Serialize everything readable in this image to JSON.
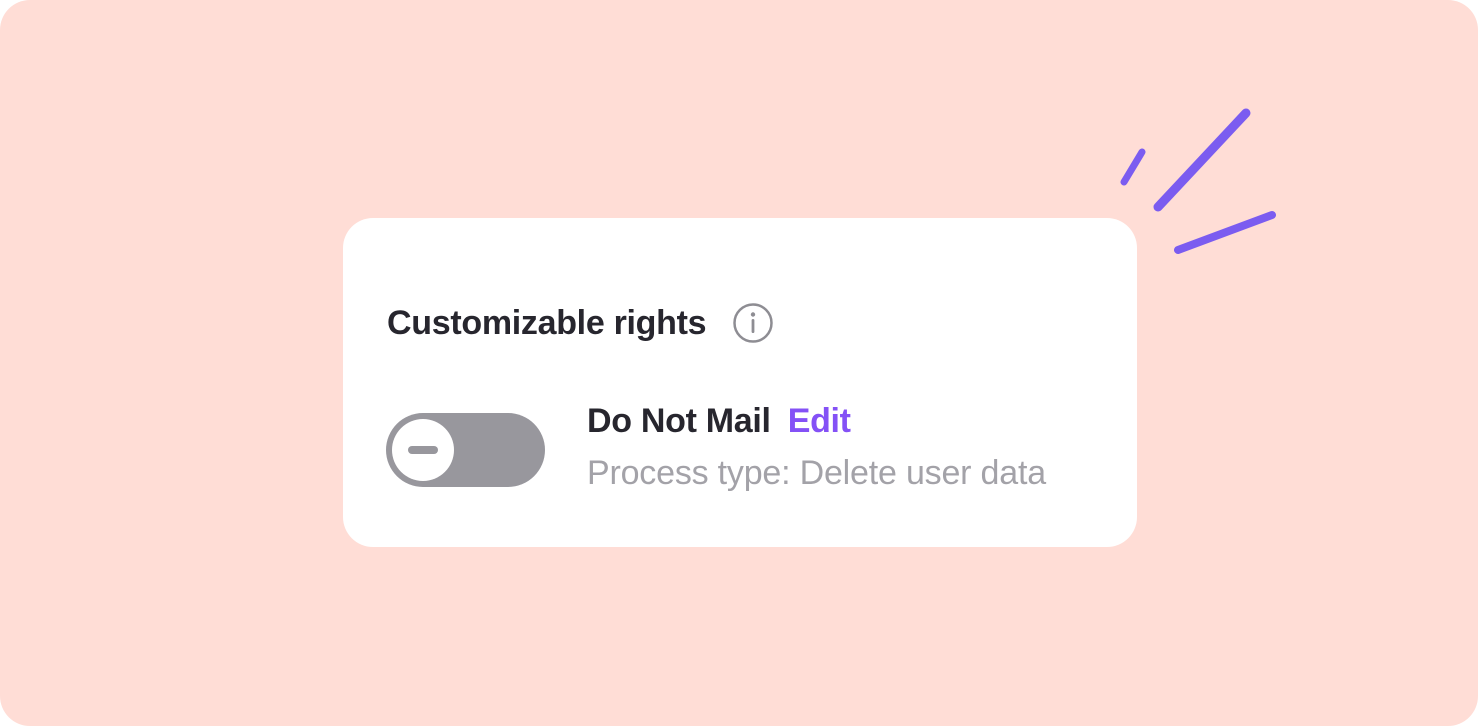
{
  "card": {
    "title": "Customizable rights",
    "info_icon": "info-circle-icon"
  },
  "right": {
    "name": "Do Not Mail",
    "edit_label": "Edit",
    "process_type": "Process type: Delete user data",
    "toggle_state": "off"
  },
  "colors": {
    "background": "#FFDDD6",
    "card": "#FFFFFF",
    "accent": "#8451F6",
    "title_text": "#27262E",
    "muted_text": "#A3A2A8",
    "toggle_off": "#98979D"
  },
  "decoration": {
    "icon": "sparkle-lines-icon"
  }
}
